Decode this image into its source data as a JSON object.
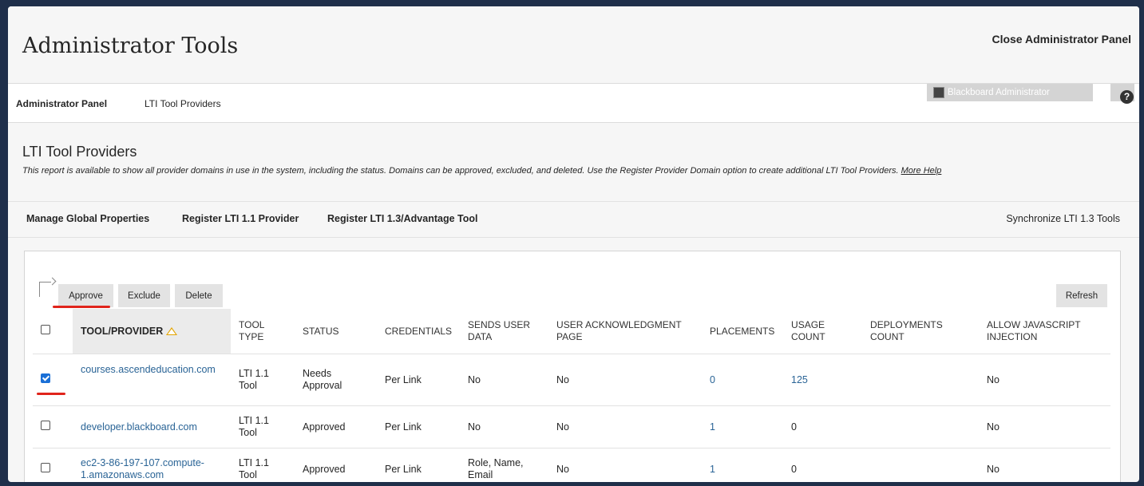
{
  "header": {
    "title": "Administrator Tools",
    "close_label": "Close Administrator Panel"
  },
  "breadcrumb": {
    "items": [
      "Administrator Panel",
      "LTI Tool Providers"
    ]
  },
  "user": {
    "name": "Blackboard Administrator"
  },
  "section": {
    "title": "LTI Tool Providers",
    "description": "This report is available to show all provider domains in use in the system, including the status. Domains can be approved, excluded, and deleted. Use the Register Provider Domain option to create additional LTI Tool Providers.",
    "more_help": "More Help"
  },
  "actions": {
    "manage_global": "Manage Global Properties",
    "register_11": "Register LTI 1.1 Provider",
    "register_13": "Register LTI 1.3/Advantage Tool",
    "sync": "Synchronize LTI 1.3 Tools"
  },
  "buttons": {
    "approve": "Approve",
    "exclude": "Exclude",
    "delete": "Delete",
    "refresh": "Refresh"
  },
  "table": {
    "headers": {
      "provider": "TOOL/PROVIDER",
      "tool_type": "TOOL TYPE",
      "status": "STATUS",
      "credentials": "CREDENTIALS",
      "sends_user_data": "SENDS USER DATA",
      "ack_page": "USER ACKNOWLEDGMENT PAGE",
      "placements": "PLACEMENTS",
      "usage_count": "USAGE COUNT",
      "deployments_count": "DEPLOYMENTS COUNT",
      "allow_js": "ALLOW JAVASCRIPT INJECTION"
    },
    "rows": [
      {
        "checked": true,
        "provider": "courses.ascendeducation.com",
        "tool_type": "LTI 1.1 Tool",
        "status": "Needs Approval",
        "credentials": "Per Link",
        "sends_user_data": "No",
        "ack_page": "No",
        "placements": "0",
        "usage_count": "125",
        "deployments_count": "",
        "allow_js": "No"
      },
      {
        "checked": false,
        "provider": "developer.blackboard.com",
        "tool_type": "LTI 1.1 Tool",
        "status": "Approved",
        "credentials": "Per Link",
        "sends_user_data": "No",
        "ack_page": "No",
        "placements": "1",
        "usage_count": "0",
        "deployments_count": "",
        "allow_js": "No"
      },
      {
        "checked": false,
        "provider": "ec2-3-86-197-107.compute-1.amazonaws.com",
        "tool_type": "LTI 1.1 Tool",
        "status": "Approved",
        "credentials": "Per Link",
        "sends_user_data": "Role, Name, Email",
        "ack_page": "No",
        "placements": "1",
        "usage_count": "0",
        "deployments_count": "",
        "allow_js": "No"
      }
    ]
  },
  "colors": {
    "accent_link": "#2a6496",
    "annotation_red": "#e0241b",
    "sort_icon": "#e2a400"
  }
}
